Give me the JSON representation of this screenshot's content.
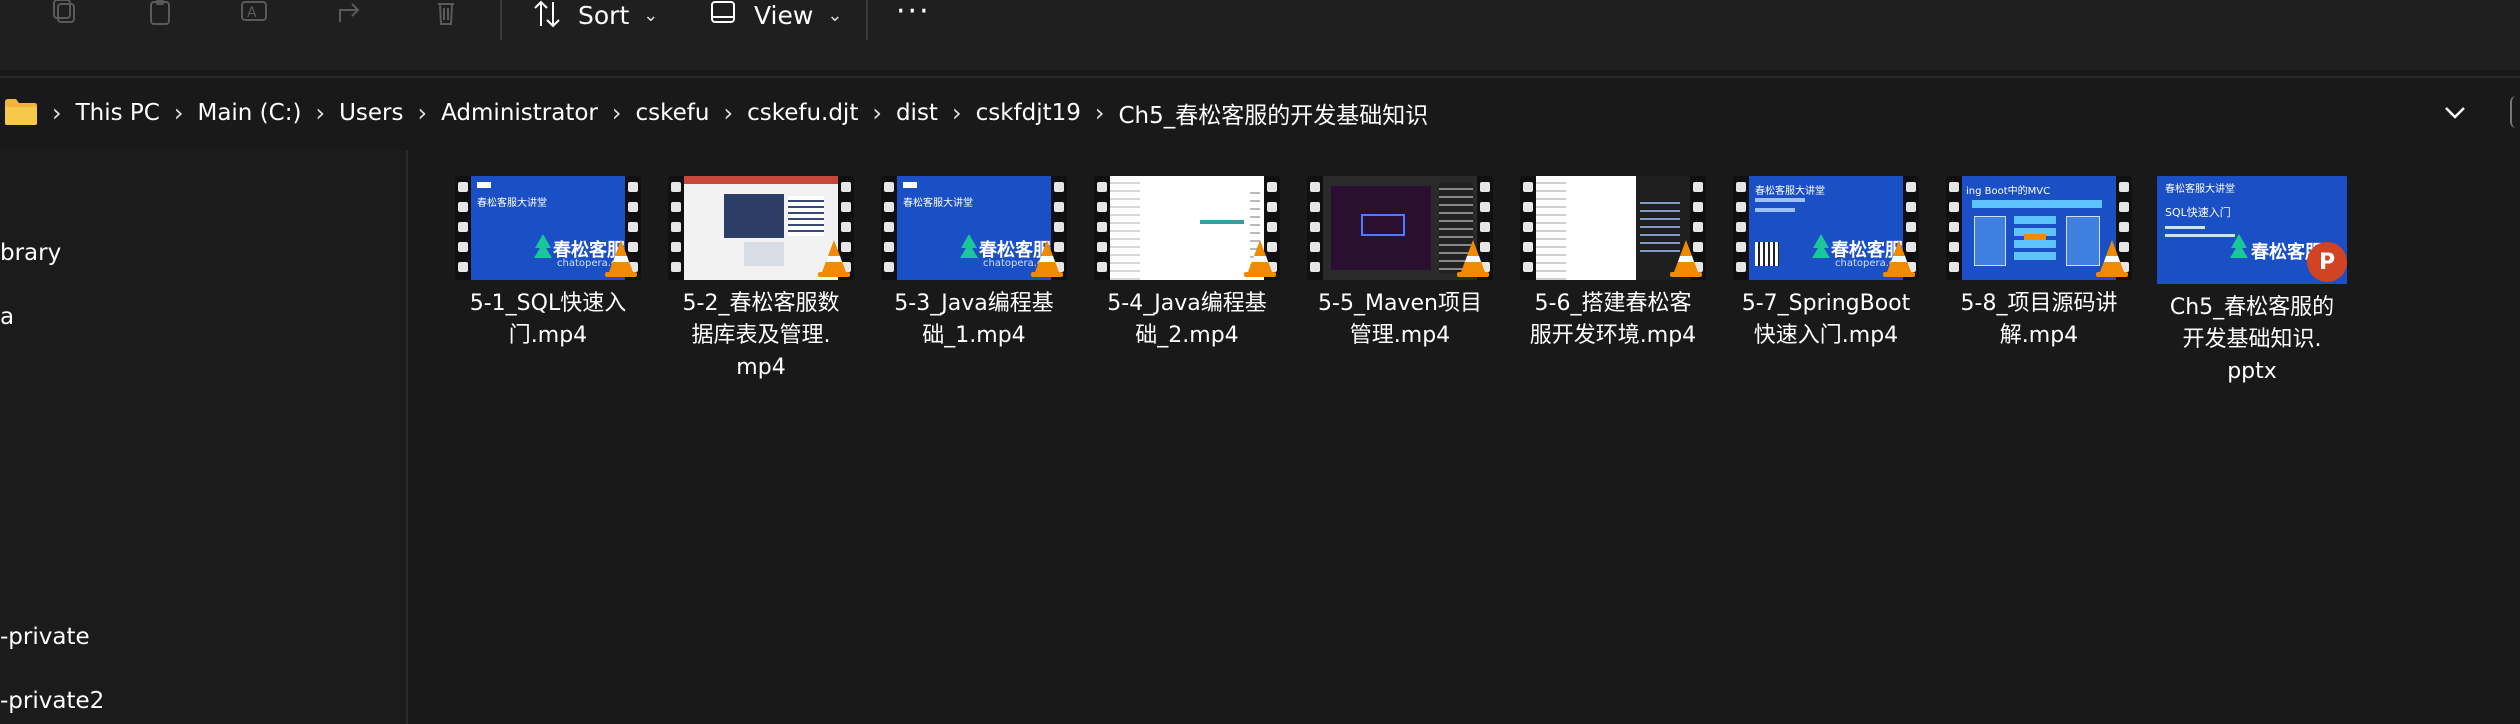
{
  "toolbar": {
    "sort_label": "Sort",
    "view_label": "View",
    "more_label": "···"
  },
  "breadcrumb": [
    "This PC",
    "Main (C:)",
    "Users",
    "Administrator",
    "cskefu",
    "cskefu.djt",
    "dist",
    "cskfdjt19",
    "Ch5_春松客服的开发基础知识"
  ],
  "sidebar": {
    "items": [
      {
        "label": "brary"
      },
      {
        "label": "a"
      },
      {
        "label": "-private"
      },
      {
        "label": "-private2"
      }
    ]
  },
  "files": [
    {
      "line1": "5-1_SQL快速入",
      "line2": "门.mp4",
      "line3": "",
      "type": "video",
      "thumb": "blue-title"
    },
    {
      "line1": "5-2_春松客服数",
      "line2": "据库表及管理.",
      "line3": "mp4",
      "type": "video",
      "thumb": "slide"
    },
    {
      "line1": "5-3_Java编程基",
      "line2": "础_1.mp4",
      "line3": "",
      "type": "video",
      "thumb": "blue-title"
    },
    {
      "line1": "5-4_Java编程基",
      "line2": "础_2.mp4",
      "line3": "",
      "type": "video",
      "thumb": "ide-light"
    },
    {
      "line1": "5-5_Maven项目",
      "line2": "管理.mp4",
      "line3": "",
      "type": "video",
      "thumb": "dark-purple"
    },
    {
      "line1": "5-6_搭建春松客",
      "line2": "服开发环境.mp4",
      "line3": "",
      "type": "video",
      "thumb": "ide-mixed"
    },
    {
      "line1": "5-7_SpringBoot",
      "line2": "快速入门.mp4",
      "line3": "",
      "type": "video",
      "thumb": "blue-qr"
    },
    {
      "line1": "5-8_项目源码讲",
      "line2": "解.mp4",
      "line3": "",
      "type": "video",
      "thumb": "diagram"
    },
    {
      "line1": "Ch5_春松客服的",
      "line2": "开发基础知识.",
      "line3": "pptx",
      "type": "pptx",
      "thumb": "ppt"
    }
  ],
  "thumb_text": {
    "course_title": "春松客服大讲堂",
    "brand": "春松客服",
    "brand_site": "chatopera.com",
    "ppt_subtitle": "SQL快速入门",
    "diagram_title": "ing Boot中的MVC",
    "ppt_badge": "P"
  },
  "colors": {
    "background": "#191919",
    "toolbar": "#1f1f1f",
    "thumb_blue": "#1b4fc6",
    "vlc_orange": "#f08a00",
    "ppt_red": "#d04423"
  }
}
